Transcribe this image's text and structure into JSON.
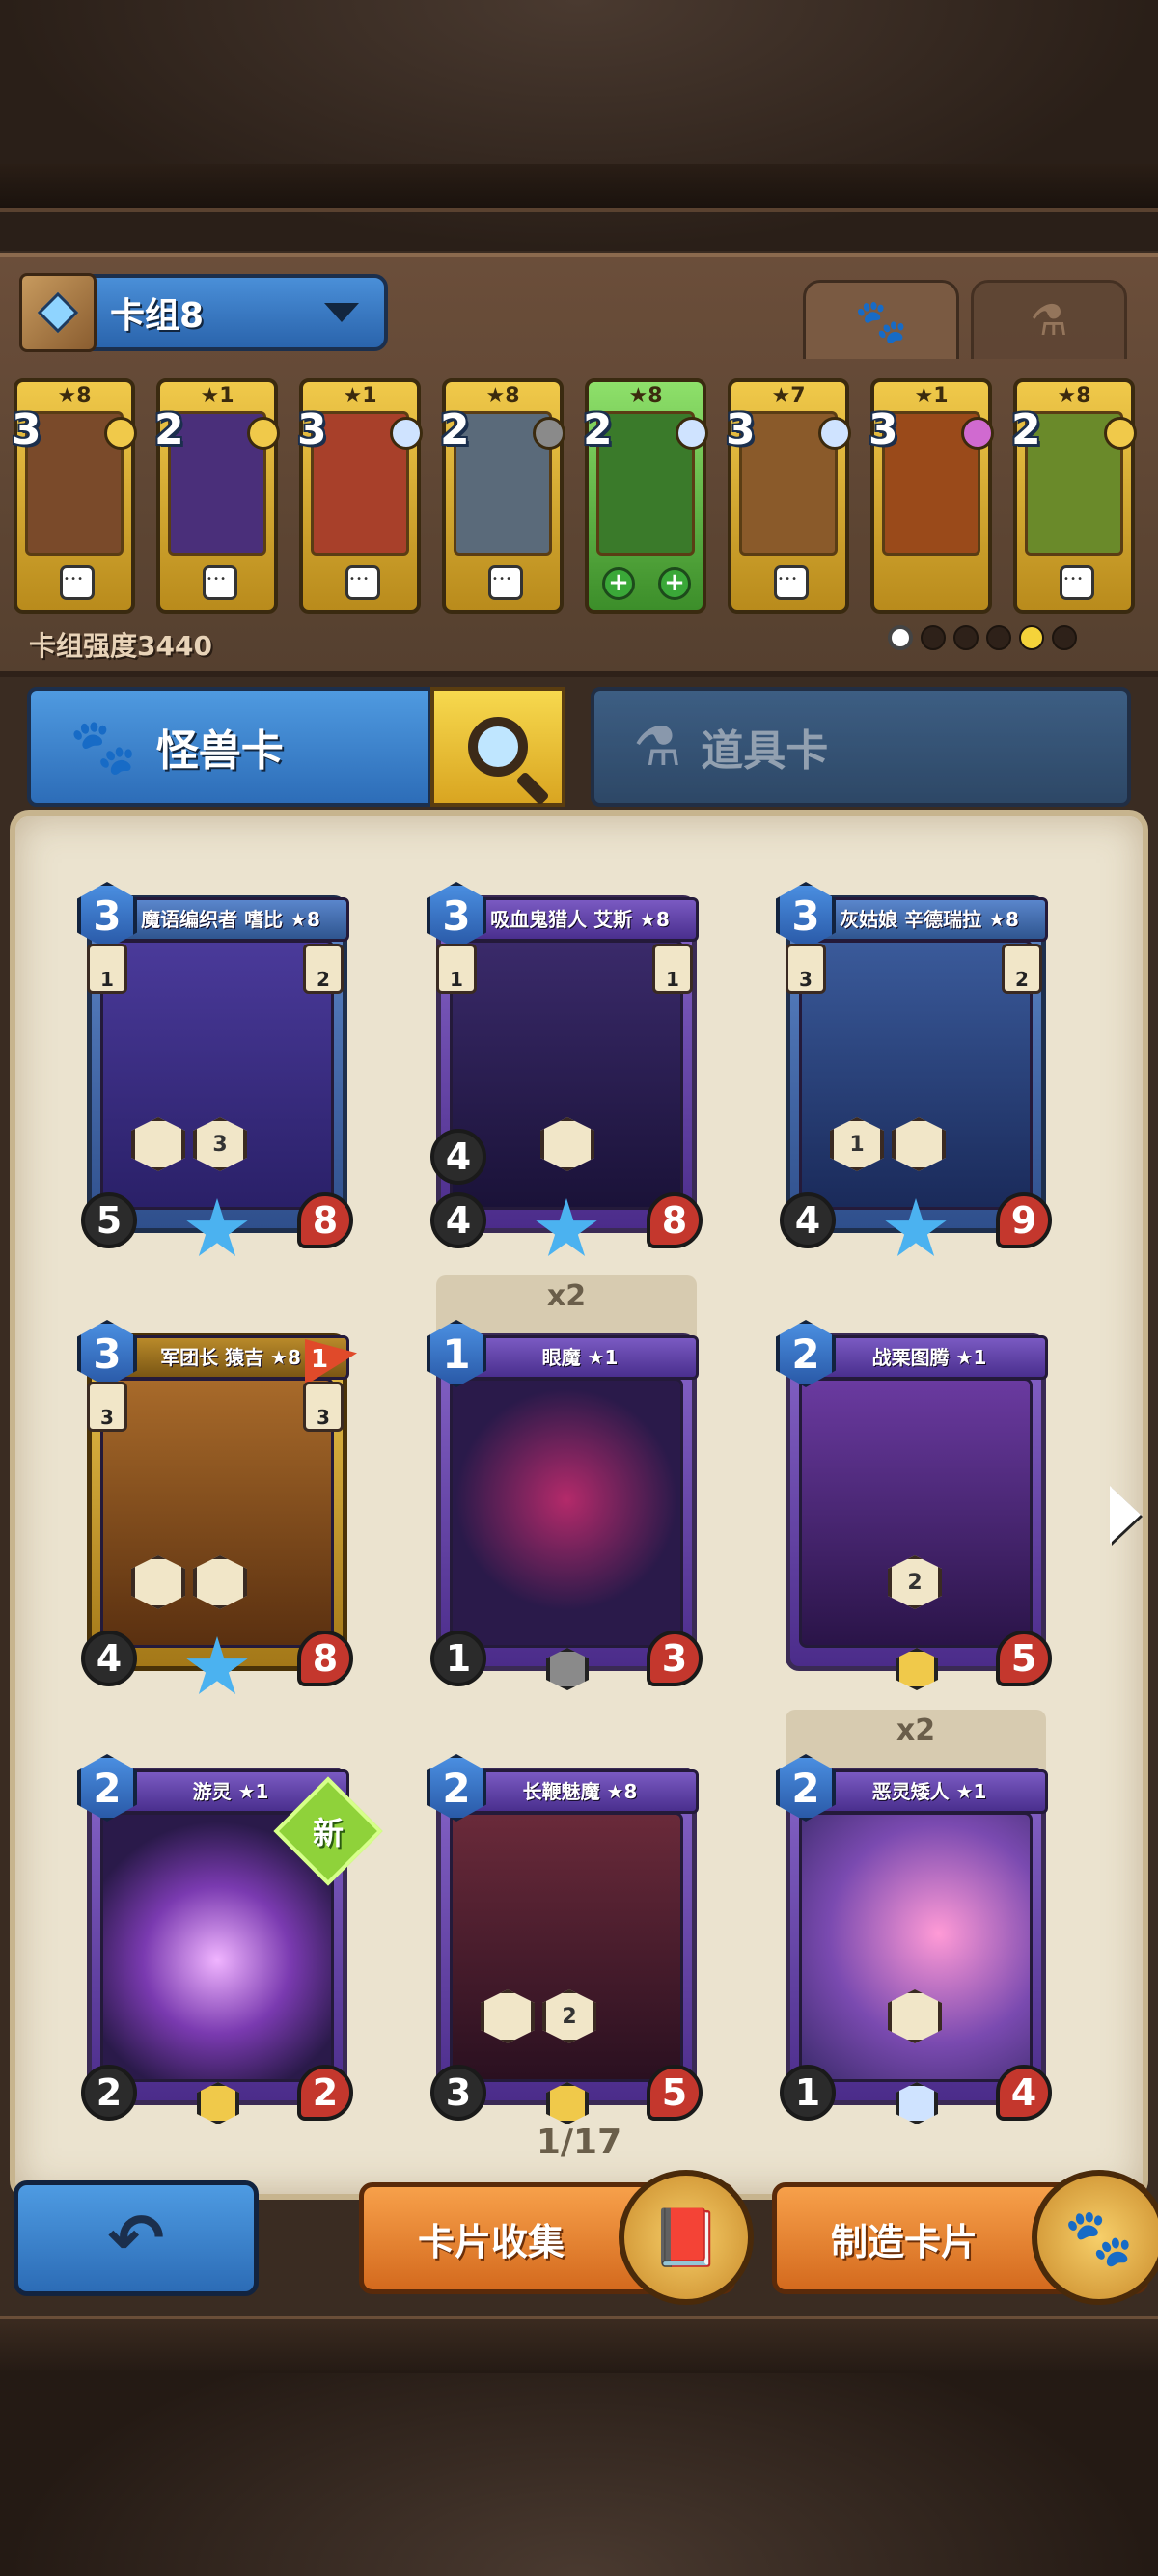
{
  "deck": {
    "name": "卡组8",
    "strength": "卡组强度3440",
    "cards": [
      {
        "stars": "★8",
        "cost": "3",
        "gem": "#f0c94a",
        "art": "#7a4a2a"
      },
      {
        "stars": "★1",
        "cost": "2",
        "gem": "#f0c94a",
        "art": "#4a2f7a"
      },
      {
        "stars": "★1",
        "cost": "3",
        "gem": "#cfe3ff",
        "art": "#a8402a"
      },
      {
        "stars": "★8",
        "cost": "2",
        "gem": "#8a8a8a",
        "art": "#5a6a7a"
      },
      {
        "stars": "★8",
        "cost": "2",
        "gem": "#cfe3ff",
        "art": "#3a7a2a"
      },
      {
        "stars": "★7",
        "cost": "3",
        "gem": "#cfe3ff",
        "art": "#8a5a2a"
      },
      {
        "stars": "★1",
        "cost": "3",
        "gem": "#d06ad0",
        "art": "#9a4a1a"
      },
      {
        "stars": "★8",
        "cost": "2",
        "gem": "#f0c94a",
        "art": "#6a8a2a"
      }
    ]
  },
  "tabs": {
    "monster": "怪兽卡",
    "item": "道具卡"
  },
  "collection": {
    "page": "1/17",
    "cards": [
      {
        "name": "魔语编织者 嗜比 ★8",
        "cost": "3",
        "atk": "5",
        "hp": "8",
        "def": "",
        "left1": "1",
        "left2": "2",
        "skill": "3"
      },
      {
        "name": "吸血鬼猎人 艾斯 ★8",
        "cost": "3",
        "atk": "4",
        "hp": "8",
        "def": "4",
        "left1": "1",
        "left2": "1",
        "skill": ""
      },
      {
        "name": "灰姑娘 辛德瑞拉 ★8",
        "cost": "3",
        "atk": "4",
        "hp": "9",
        "def": "",
        "left1": "3",
        "left2": "2",
        "skill": "1"
      },
      {
        "name": "军团长 猿吉 ★8",
        "cost": "3",
        "atk": "4",
        "hp": "8",
        "def": "",
        "left1": "3",
        "left2": "3",
        "skill": "",
        "flag": "1"
      },
      {
        "name": "眼魔 ★1",
        "cost": "1",
        "atk": "1",
        "hp": "3",
        "def": "",
        "dupe": "x2"
      },
      {
        "name": "战栗图腾 ★1",
        "cost": "2",
        "atk": "",
        "hp": "5",
        "def": "",
        "skill": "2"
      },
      {
        "name": "游灵 ★1",
        "cost": "2",
        "atk": "2",
        "hp": "2",
        "def": "",
        "new": "新"
      },
      {
        "name": "长鞭魅魔 ★8",
        "cost": "2",
        "atk": "3",
        "hp": "5",
        "def": "",
        "skill": "2"
      },
      {
        "name": "恶灵矮人 ★1",
        "cost": "2",
        "atk": "1",
        "hp": "4",
        "def": "",
        "dupe": "x2"
      }
    ]
  },
  "buttons": {
    "collect": "卡片收集",
    "craft": "制造卡片"
  }
}
